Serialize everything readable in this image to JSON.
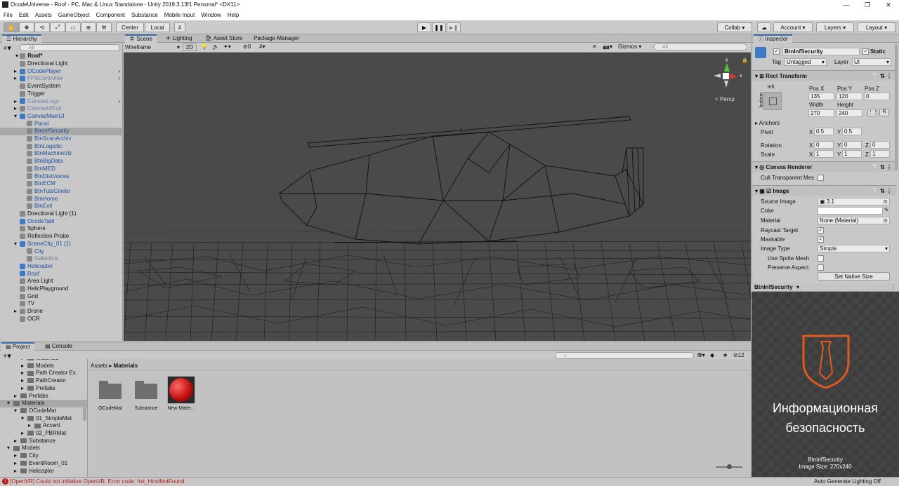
{
  "window": {
    "title": "OcodeUniverse - Roof - PC, Mac & Linux Standalone - Unity 2019.3.13f1 Personal* <DX11>"
  },
  "menu": [
    "File",
    "Edit",
    "Assets",
    "GameObject",
    "Component",
    "Substance",
    "Mobile Input",
    "Window",
    "Help"
  ],
  "toolbar": {
    "center": "Center",
    "local": "Local",
    "collab": "Collab ▾",
    "account": "Account ▾",
    "layers": "Layers ▾",
    "layout": "Layout ▾"
  },
  "hierarchy": {
    "tab": "Hierarchy",
    "search": "All",
    "scene": "Roof*",
    "items": [
      {
        "label": "Directional Light",
        "indent": 1,
        "prefab": false,
        "arrow": ""
      },
      {
        "label": "OCodePlayer",
        "indent": 1,
        "prefab": true,
        "arrow": "▸"
      },
      {
        "label": "FPSController",
        "indent": 1,
        "prefab": true,
        "arrow": "▸",
        "dim": true
      },
      {
        "label": "EventSystem",
        "indent": 1,
        "prefab": false,
        "arrow": ""
      },
      {
        "label": "Trigger",
        "indent": 1,
        "prefab": false,
        "arrow": ""
      },
      {
        "label": "CanvasLogo",
        "indent": 1,
        "prefab": true,
        "arrow": "▸",
        "dim": true
      },
      {
        "label": "CanvasUIExit",
        "indent": 1,
        "prefab": false,
        "arrow": "▸",
        "dim": true
      },
      {
        "label": "CanvasMainUI",
        "indent": 1,
        "prefab": true,
        "arrow": "▾"
      },
      {
        "label": "Panel",
        "indent": 2,
        "prefab": false,
        "arrow": "",
        "blue": true
      },
      {
        "label": "BtnInfSecurity",
        "indent": 2,
        "prefab": false,
        "arrow": "",
        "blue": true,
        "selected": true
      },
      {
        "label": "BtnScanArchiv",
        "indent": 2,
        "prefab": false,
        "arrow": "",
        "blue": true
      },
      {
        "label": "BtnLogistic",
        "indent": 2,
        "prefab": false,
        "arrow": "",
        "blue": true
      },
      {
        "label": "BtnMachineViz",
        "indent": 2,
        "prefab": false,
        "arrow": "",
        "blue": true
      },
      {
        "label": "BtnBigData",
        "indent": 2,
        "prefab": false,
        "arrow": "",
        "blue": true
      },
      {
        "label": "BtnMED",
        "indent": 2,
        "prefab": false,
        "arrow": "",
        "blue": true
      },
      {
        "label": "BtnDistVoices",
        "indent": 2,
        "prefab": false,
        "arrow": "",
        "blue": true
      },
      {
        "label": "BtnECM",
        "indent": 2,
        "prefab": false,
        "arrow": "",
        "blue": true
      },
      {
        "label": "BtnTutsCenter",
        "indent": 2,
        "prefab": false,
        "arrow": "",
        "blue": true
      },
      {
        "label": "BtnHome",
        "indent": 2,
        "prefab": false,
        "arrow": "",
        "blue": true
      },
      {
        "label": "BtnExit",
        "indent": 2,
        "prefab": false,
        "arrow": "",
        "blue": true
      },
      {
        "label": "Directional Light (1)",
        "indent": 1,
        "prefab": false,
        "arrow": ""
      },
      {
        "label": "OcodeTabl",
        "indent": 1,
        "prefab": true,
        "arrow": "",
        "blue": true
      },
      {
        "label": "Sphere",
        "indent": 1,
        "prefab": false,
        "arrow": ""
      },
      {
        "label": "Reflection Probe",
        "indent": 1,
        "prefab": false,
        "arrow": ""
      },
      {
        "label": "SceneCity_01 (1)",
        "indent": 1,
        "prefab": true,
        "arrow": "▾",
        "blue": true
      },
      {
        "label": "City",
        "indent": 2,
        "prefab": false,
        "arrow": "",
        "blue": true
      },
      {
        "label": "Galactica",
        "indent": 2,
        "prefab": false,
        "arrow": "",
        "dim": true
      },
      {
        "label": "Helicopter",
        "indent": 1,
        "prefab": true,
        "arrow": "",
        "blue": true
      },
      {
        "label": "Roof",
        "indent": 1,
        "prefab": true,
        "arrow": "",
        "blue": true
      },
      {
        "label": "Area Light",
        "indent": 1,
        "prefab": false,
        "arrow": ""
      },
      {
        "label": "HelicPlayground",
        "indent": 1,
        "prefab": false,
        "arrow": ""
      },
      {
        "label": "Grid",
        "indent": 1,
        "prefab": false,
        "arrow": ""
      },
      {
        "label": "TV",
        "indent": 1,
        "prefab": false,
        "arrow": ""
      },
      {
        "label": "Drone",
        "indent": 1,
        "prefab": false,
        "arrow": "▸"
      },
      {
        "label": "OCR",
        "indent": 1,
        "prefab": false,
        "arrow": ""
      }
    ]
  },
  "scene": {
    "tabs": [
      "Scene",
      "Lighting",
      "Asset Store",
      "Package Manager"
    ],
    "shading": "Wireframe",
    "mode2d": "2D",
    "hidden_count": "0",
    "gizmos": "Gizmos",
    "search": "All",
    "persp": "< Persp",
    "axis_x": "x",
    "axis_y": "y"
  },
  "inspector": {
    "tab": "Inspector",
    "object_name": "BtnInfSecurity",
    "static_label": "Static",
    "tag_label": "Tag",
    "tag": "Untagged",
    "layer_label": "Layer",
    "layer": "UI",
    "rect": {
      "title": "Rect Transform",
      "anchor_h": "left",
      "anchor_v": "bottom",
      "posx_label": "Pos X",
      "posy_label": "Pos Y",
      "posz_label": "Pos Z",
      "posx": "135",
      "posy": "120",
      "posz": "0",
      "width_label": "Width",
      "height_label": "Height",
      "width": "270",
      "height": "240",
      "anchors": "Anchors",
      "pivot": "Pivot",
      "pivot_x": "0.5",
      "pivot_y": "0.5",
      "rotation": "Rotation",
      "rot_x": "0",
      "rot_y": "0",
      "rot_z": "0",
      "scale": "Scale",
      "scale_x": "1",
      "scale_y": "1",
      "scale_z": "1",
      "r": "R"
    },
    "canvas_renderer": {
      "title": "Canvas Renderer",
      "cull": "Cull Transparent Mes"
    },
    "image": {
      "title": "Image",
      "source_label": "Source Image",
      "source": "3.1",
      "color_label": "Color",
      "material_label": "Material",
      "material": "None (Material)",
      "raycast": "Raycast Target",
      "maskable": "Maskable",
      "type_label": "Image Type",
      "type": "Simple",
      "sprite_mesh": "Use Sprite Mesh",
      "preserve": "Preserve Aspect",
      "native": "Set Native Size"
    }
  },
  "preview": {
    "header": "BtnInfSecurity",
    "line1": "Информационная",
    "line2": "безопасность",
    "name": "BtnInfSecurity",
    "size": "Image Size: 270x240",
    "accent": "#e0591e"
  },
  "project": {
    "tabs": [
      "Project",
      "Console"
    ],
    "breadcrumb_root": "Assets",
    "breadcrumb_sep": "▸",
    "breadcrumb_current": "Materials",
    "count": "12",
    "tree": [
      {
        "label": "Materials",
        "indent": 2,
        "cut": true
      },
      {
        "label": "Models",
        "indent": 2
      },
      {
        "label": "Path Creator Ex",
        "indent": 2
      },
      {
        "label": "PathCreator",
        "indent": 2
      },
      {
        "label": "Prefabs",
        "indent": 2
      },
      {
        "label": "Prefabs",
        "indent": 1
      },
      {
        "label": "Materials",
        "indent": 0,
        "selected": true
      },
      {
        "label": "OCodeMat",
        "indent": 1
      },
      {
        "label": "01_SimpleMat",
        "indent": 2
      },
      {
        "label": "Accent",
        "indent": 3
      },
      {
        "label": "02_PBRMat",
        "indent": 2
      },
      {
        "label": "Substance",
        "indent": 1
      },
      {
        "label": "Models",
        "indent": 0
      },
      {
        "label": "City",
        "indent": 1
      },
      {
        "label": "EventRoom_01",
        "indent": 1
      },
      {
        "label": "Helicopter",
        "indent": 1
      }
    ],
    "assets": [
      {
        "label": "OCodeMat",
        "kind": "folder"
      },
      {
        "label": "Substance",
        "kind": "folder"
      },
      {
        "label": "New Mater...",
        "kind": "material"
      }
    ]
  },
  "status": {
    "message": "[OpenVR] Could not initialize OpenVR. Error code: Init_HmdNotFound",
    "right": "Auto Generate Lighting Off",
    "error_color": "#c01818"
  }
}
